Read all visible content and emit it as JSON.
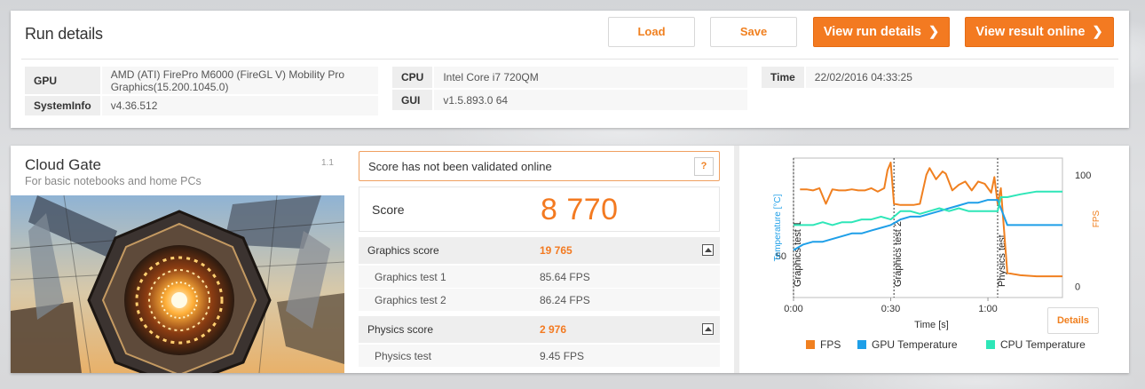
{
  "run": {
    "title": "Run details",
    "buttons": {
      "load": "Load",
      "save": "Save",
      "view_run_details": "View run details",
      "view_result_online": "View result online"
    },
    "info": {
      "gpu_label": "GPU",
      "gpu_value": "AMD (ATI) FirePro M6000 (FireGL V) Mobility Pro Graphics(15.200.1045.0)",
      "systeminfo_label": "SystemInfo",
      "systeminfo_value": "v4.36.512",
      "cpu_label": "CPU",
      "cpu_value": "Intel Core i7 720QM",
      "gui_label": "GUI",
      "gui_value": "v1.5.893.0 64",
      "time_label": "Time",
      "time_value": "22/02/2016 04:33:25"
    }
  },
  "test": {
    "name": "Cloud Gate",
    "description": "For basic notebooks and home PCs",
    "version": "1.1",
    "validation_message": "Score has not been validated online",
    "help_label": "?",
    "score_label": "Score",
    "score_value": "8 770",
    "graphics": {
      "label": "Graphics score",
      "value": "19 765",
      "tests": [
        {
          "label": "Graphics test 1",
          "value": "85.64 FPS"
        },
        {
          "label": "Graphics test 2",
          "value": "86.24 FPS"
        }
      ]
    },
    "physics": {
      "label": "Physics score",
      "value": "2 976",
      "tests": [
        {
          "label": "Physics test",
          "value": "9.45 FPS"
        }
      ]
    },
    "details_label": "Details"
  },
  "colors": {
    "accent": "#f37a21",
    "fps": "#f08020",
    "gpu_temp": "#1e9fe8",
    "cpu_temp": "#2ee6b8"
  },
  "chart_data": {
    "type": "line",
    "xlabel": "Time [s]",
    "ylabel_left": "Temperature [°C]",
    "ylabel_right": "FPS",
    "x_ticks": [
      "0:00",
      "0:30",
      "1:00"
    ],
    "y_left_ticks": [
      50
    ],
    "y_right_ticks": [
      0,
      100
    ],
    "x_range_s": [
      0,
      83
    ],
    "y_left_range": [
      35,
      85
    ],
    "y_right_range": [
      -10,
      115
    ],
    "sections": [
      {
        "label": "Graphics test 1",
        "start_s": 0
      },
      {
        "label": "Graphics test 2",
        "start_s": 31
      },
      {
        "label": "Physics test",
        "start_s": 63
      }
    ],
    "legend": [
      "FPS",
      "GPU Temperature",
      "CPU Temperature"
    ],
    "legend_position": "bottom",
    "series": [
      {
        "name": "FPS",
        "axis": "right",
        "x": [
          2,
          4,
          6,
          8,
          10,
          12,
          14,
          16,
          18,
          20,
          22,
          24,
          26,
          28,
          29,
          30,
          31,
          33,
          35,
          37,
          39,
          41,
          42,
          44,
          46,
          47,
          49,
          51,
          53,
          55,
          57,
          59,
          61,
          62,
          63,
          64,
          66,
          70,
          75,
          80,
          83
        ],
        "values": [
          87,
          87,
          86,
          88,
          74,
          87,
          86,
          86,
          87,
          86,
          86,
          88,
          85,
          88,
          104,
          111,
          74,
          73,
          73,
          73,
          74,
          100,
          106,
          96,
          103,
          101,
          86,
          91,
          94,
          86,
          94,
          92,
          84,
          98,
          74,
          88,
          12,
          10,
          9,
          9,
          9
        ]
      },
      {
        "name": "GPU Temperature",
        "axis": "left",
        "x": [
          0,
          3,
          6,
          9,
          12,
          15,
          18,
          21,
          24,
          27,
          30,
          33,
          36,
          39,
          42,
          45,
          48,
          51,
          54,
          57,
          60,
          63,
          66,
          70,
          75,
          80,
          83
        ],
        "values": [
          52,
          54,
          55,
          55,
          56,
          57,
          58,
          58,
          59,
          60,
          61,
          63,
          64,
          64,
          65,
          66,
          67,
          68,
          69,
          69,
          70,
          70,
          61,
          61,
          61,
          61,
          61
        ]
      },
      {
        "name": "CPU Temperature",
        "axis": "left",
        "x": [
          0,
          3,
          6,
          9,
          12,
          15,
          18,
          21,
          24,
          27,
          30,
          33,
          36,
          39,
          42,
          45,
          48,
          51,
          54,
          57,
          60,
          63,
          64,
          66,
          70,
          75,
          80,
          83
        ],
        "values": [
          61,
          61,
          61,
          62,
          61,
          62,
          62,
          63,
          63,
          64,
          63,
          66,
          66,
          65,
          66,
          67,
          66,
          67,
          66,
          66,
          66,
          66,
          71,
          71,
          72,
          73,
          73,
          73
        ]
      }
    ]
  }
}
